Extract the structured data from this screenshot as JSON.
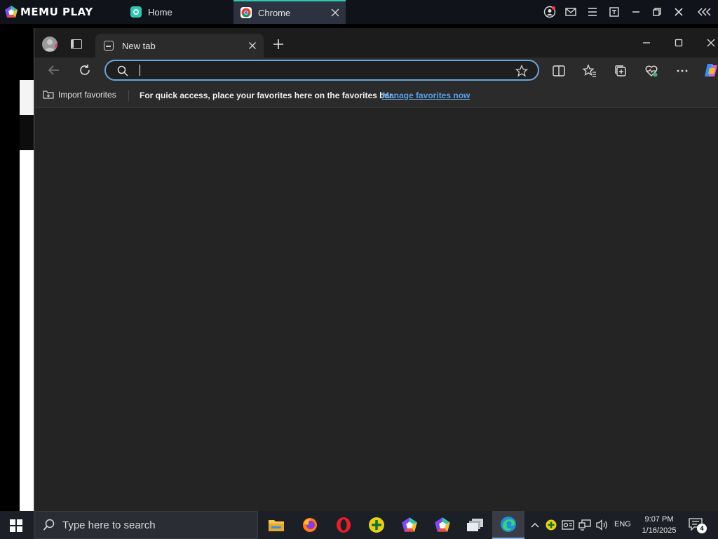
{
  "memu": {
    "brand": "MEMU PLAY",
    "tabs": [
      {
        "label": "Home",
        "icon": "memu-home-icon"
      },
      {
        "label": "Chrome",
        "icon": "chrome-icon"
      }
    ],
    "accent": "#2fc7b0"
  },
  "edge": {
    "tab": {
      "title": "New tab"
    },
    "address_bar": {
      "value": "",
      "placeholder": ""
    },
    "favorites_bar": {
      "import_label": "Import favorites",
      "message": "For quick access, place your favorites here on the favorites bar.",
      "manage_link": "Manage favorites now"
    },
    "focus_color": "#6aa6d8",
    "link_color": "#5aa0e6"
  },
  "taskbar": {
    "search_placeholder": "Type here to search",
    "apps": [
      "file-explorer-icon",
      "firefox-icon",
      "opera-icon",
      "memu-multi-icon",
      "memu-icon",
      "memu-icon-2",
      "multitask-icon",
      "edge-icon"
    ],
    "language": "ENG",
    "time": "9:07 PM",
    "date": "1/16/2025",
    "notification_count": "4"
  }
}
